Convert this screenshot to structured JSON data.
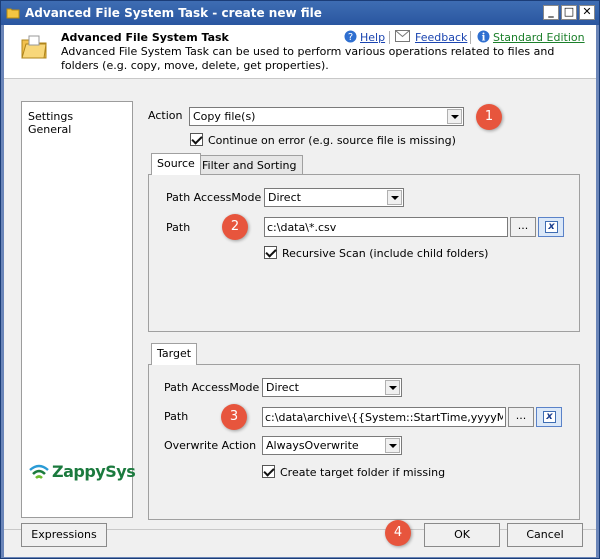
{
  "window": {
    "title": "Advanced File System Task - create new file"
  },
  "title_buttons": {
    "minimize": "_",
    "maximize": "□",
    "close": "✕"
  },
  "header": {
    "title": "Advanced File System Task",
    "description": "Advanced File System Task can be used to perform various operations related to files and folders (e.g. copy, move, delete, get properties).",
    "links": {
      "help": "Help",
      "feedback": "Feedback",
      "edition": "Standard Edition"
    }
  },
  "sidebar": {
    "items": [
      {
        "label": "Settings"
      },
      {
        "label": "General"
      }
    ],
    "logo": "ZappySys"
  },
  "action": {
    "label": "Action",
    "value": "Copy file(s)"
  },
  "continue_on_error": {
    "label": "Continue on error (e.g. source file is missing)",
    "checked": true
  },
  "source_tabs": [
    {
      "label": "Source"
    },
    {
      "label": "Filter and Sorting"
    }
  ],
  "source": {
    "path_access_mode_label": "Path AccessMode",
    "path_access_mode_value": "Direct",
    "path_label": "Path",
    "path_value": "c:\\data\\*.csv",
    "browse_label": "...",
    "recursive_label": "Recursive Scan (include child folders)",
    "recursive_checked": true
  },
  "target_tabs": [
    {
      "label": "Target"
    }
  ],
  "target": {
    "path_access_mode_label": "Path AccessMode",
    "path_access_mode_value": "Direct",
    "path_label": "Path",
    "path_value": "c:\\data\\archive\\{{System::StartTime,yyyyMMdd}}\\",
    "browse_label": "...",
    "overwrite_label": "Overwrite Action",
    "overwrite_value": "AlwaysOverwrite",
    "create_folder_label": "Create target folder if missing",
    "create_folder_checked": true
  },
  "callouts": {
    "c1": "1",
    "c2": "2",
    "c3": "3",
    "c4": "4"
  },
  "footer": {
    "expressions": "Expressions",
    "ok": "OK",
    "cancel": "Cancel"
  },
  "colors": {
    "callout": "#e7553d",
    "titlebar": "#2a56a0",
    "link": "#1a44b0",
    "edition_link": "#1b7f2a"
  }
}
